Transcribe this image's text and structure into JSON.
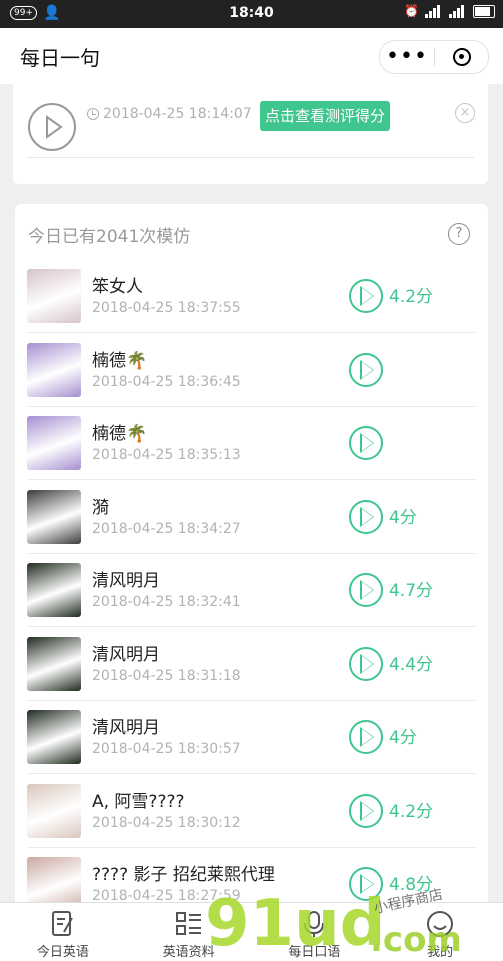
{
  "status_bar": {
    "badge": "99+",
    "time": "18:40"
  },
  "nav": {
    "title": "每日一句",
    "more_label": "•••"
  },
  "last_attempt": {
    "timestamp": "2018-04-25 18:14:07",
    "score_button": "点击查看测评得分",
    "close_symbol": "×"
  },
  "imitations": {
    "header": "今日已有2041次模仿",
    "help_symbol": "?",
    "items": [
      {
        "name": "笨女人",
        "time": "2018-04-25 18:37:55",
        "score": "4.2分",
        "avatar": "#d7c3c9"
      },
      {
        "name": "楠德🌴",
        "time": "2018-04-25 18:36:45",
        "score": "",
        "avatar": "#a58fd0"
      },
      {
        "name": "楠德🌴",
        "time": "2018-04-25 18:35:13",
        "score": "",
        "avatar": "#a58fd0"
      },
      {
        "name": "漪",
        "time": "2018-04-25 18:34:27",
        "score": "4分",
        "avatar": "#3b3b3b"
      },
      {
        "name": "清风明月",
        "time": "2018-04-25 18:32:41",
        "score": "4.7分",
        "avatar": "#1f2a1e"
      },
      {
        "name": "清风明月",
        "time": "2018-04-25 18:31:18",
        "score": "4.4分",
        "avatar": "#1f2a1e"
      },
      {
        "name": "清风明月",
        "time": "2018-04-25 18:30:57",
        "score": "4分",
        "avatar": "#1f2a1e"
      },
      {
        "name": "A, 阿雪????",
        "time": "2018-04-25 18:30:12",
        "score": "4.2分",
        "avatar": "#d9c7bd"
      },
      {
        "name": "???? 影子 招纪莱熙代理",
        "time": "2018-04-25 18:27:59",
        "score": "4.8分",
        "avatar": "#c9a8a0"
      }
    ]
  },
  "tabbar": {
    "tabs": [
      {
        "label": "今日英语"
      },
      {
        "label": "英语资料"
      },
      {
        "label": "每日口语"
      },
      {
        "label": "我的"
      }
    ]
  },
  "watermark": {
    "main": "91ud",
    "suffix": ".com",
    "tag": "小程序商店"
  },
  "colors": {
    "accent": "#3fc68f",
    "status_bar": "#222222",
    "background": "#efefef"
  }
}
